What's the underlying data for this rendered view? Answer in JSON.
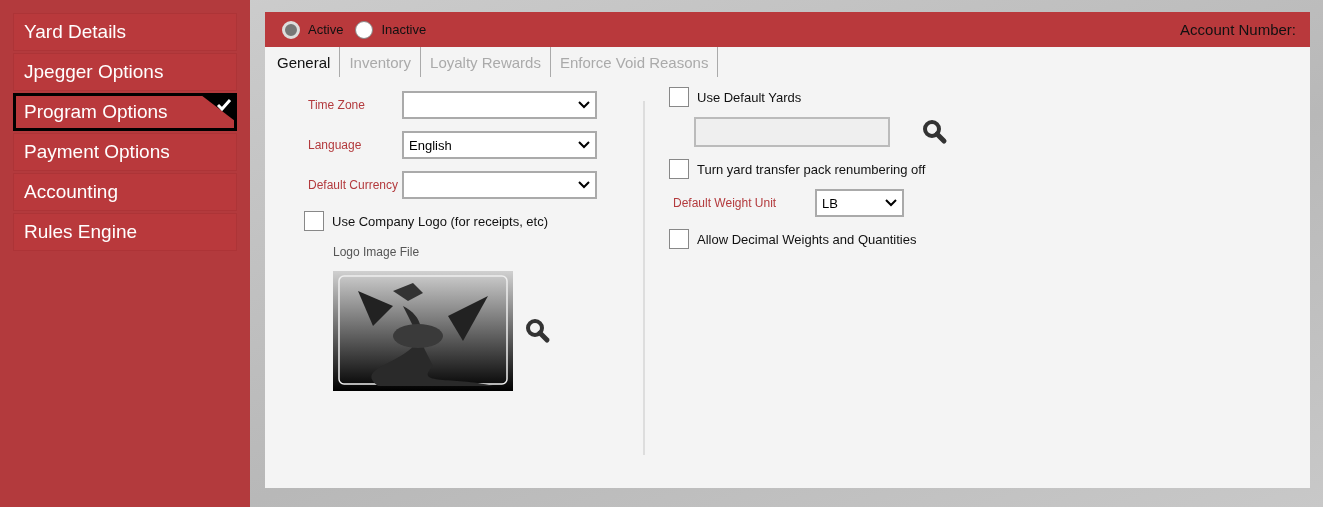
{
  "sidebar": {
    "items": [
      {
        "label": "Yard Details",
        "selected": false
      },
      {
        "label": "Jpegger Options",
        "selected": false
      },
      {
        "label": "Program Options",
        "selected": true
      },
      {
        "label": "Payment Options",
        "selected": false
      },
      {
        "label": "Accounting",
        "selected": false
      },
      {
        "label": "Rules Engine",
        "selected": false
      }
    ]
  },
  "status": [
    {
      "label": "Active",
      "selected": true
    },
    {
      "label": "Inactive",
      "selected": false
    }
  ],
  "account_number": "Account Number:",
  "tabs": [
    {
      "label": "General",
      "selected": true
    },
    {
      "label": "Inventory",
      "selected": false
    },
    {
      "label": "Loyalty Rewards",
      "selected": false
    },
    {
      "label": "Enforce Void Reasons",
      "selected": false
    }
  ],
  "left_column": [
    {
      "kind": "select",
      "label": "Time Zone"
    },
    {
      "kind": "select",
      "label": "Language",
      "value": "English"
    },
    {
      "kind": "select",
      "label": "Default Currency"
    },
    {
      "kind": "checkbox",
      "label": "Use Company Logo (for receipts, etc)",
      "checked": false
    },
    {
      "label": "Logo Image File"
    }
  ],
  "right_column": [
    {
      "kind": "checkbox",
      "label": "Use Default Yards",
      "checked": false
    },
    {
      "kind": "lookup",
      "disabled": true
    },
    {
      "kind": "checkbox",
      "label": "Turn yard transfer pack renumbering off",
      "checked": false
    },
    {
      "kind": "select",
      "label": "Default Weight Unit",
      "value": "LB"
    },
    {
      "kind": "checkbox",
      "label": "Allow Decimal Weights and Quantities",
      "checked": false
    }
  ]
}
